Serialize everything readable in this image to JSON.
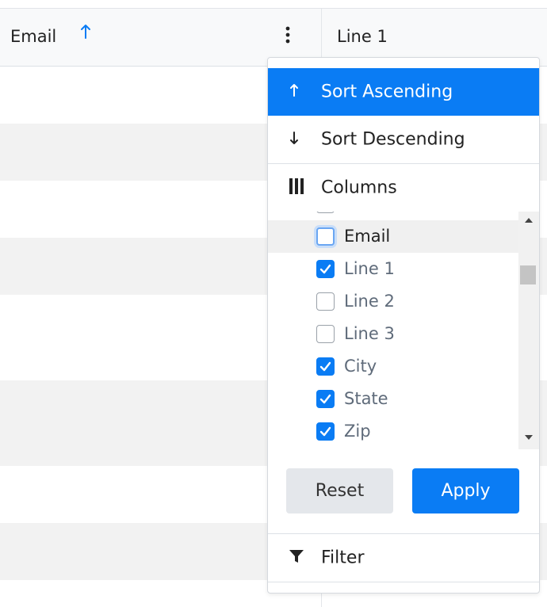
{
  "grid": {
    "columns": [
      {
        "label": "Email",
        "sort": "ascending"
      },
      {
        "label": "Line 1"
      }
    ]
  },
  "icons": {
    "sort_ascending": "arrow-up-icon",
    "sort_descending": "arrow-down-icon",
    "columns": "columns-icon",
    "filter": "filter-icon",
    "menu": "kebab-menu-icon"
  },
  "menu": {
    "sort_ascending_label": "Sort Ascending",
    "sort_descending_label": "Sort Descending",
    "columns_label": "Columns",
    "column_items": [
      {
        "label": "",
        "checked": false
      },
      {
        "label": "Email",
        "checked": false
      },
      {
        "label": "Line 1",
        "checked": true
      },
      {
        "label": "Line 2",
        "checked": false
      },
      {
        "label": "Line 3",
        "checked": false
      },
      {
        "label": "City",
        "checked": true
      },
      {
        "label": "State",
        "checked": true
      },
      {
        "label": "Zip",
        "checked": true
      }
    ],
    "reset_label": "Reset",
    "apply_label": "Apply",
    "filter_label": "Filter"
  },
  "colors": {
    "accent": "#0a7cf4",
    "row_alt": "#f2f2f2",
    "header_bg": "#f8f9fa"
  }
}
